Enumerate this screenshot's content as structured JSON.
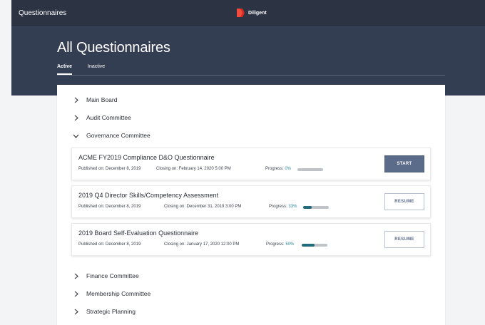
{
  "app": {
    "title": "Questionnaires",
    "brand": "Diligent"
  },
  "header": {
    "title": "All Questionnaires",
    "tabs": [
      {
        "label": "Active",
        "active": true
      },
      {
        "label": "Inactive",
        "active": false
      }
    ]
  },
  "groups": {
    "main_board": "Main Board",
    "audit": "Audit Committee",
    "governance": "Governance Committee",
    "finance": "Finance Committee",
    "membership": "Membership Committee",
    "strategic": "Strategic Planning"
  },
  "questionnaires": [
    {
      "title": "ACME FY2019 Compliance D&O Questionnaire",
      "published": "Published on: December 8, 2019",
      "closing": "Closing on: February 14, 2020 5:00 PM",
      "progress_label": "Progress:",
      "progress_pct": "0%",
      "progress": 0,
      "action": "START"
    },
    {
      "title": "2019 Q4 Director Skills/Competency Assessment",
      "published": "Published on: December 8, 2019",
      "closing": "Closing on: December 31, 2019 3:00 PM",
      "progress_label": "Progress:",
      "progress_pct": "33%",
      "progress": 0.33,
      "action": "RESUME"
    },
    {
      "title": "2019 Board Self-Evaluation Questionnaire",
      "published": "Published on: December 8, 2019",
      "closing": "Closing on: January 17, 2020 12:00 PM",
      "progress_label": "Progress:",
      "progress_pct": "50%",
      "progress": 0.5,
      "action": "RESUME"
    }
  ],
  "colors": {
    "topbar": "#2c3444",
    "header": "#343e52",
    "primary_button": "#5b6b8a",
    "progress_fill": "#1f6b7a",
    "brand_red": "#d52b1e"
  },
  "icons": {
    "collapsed": "chevron-right-icon",
    "expanded": "chevron-down-icon",
    "brand": "diligent-logo-icon"
  }
}
